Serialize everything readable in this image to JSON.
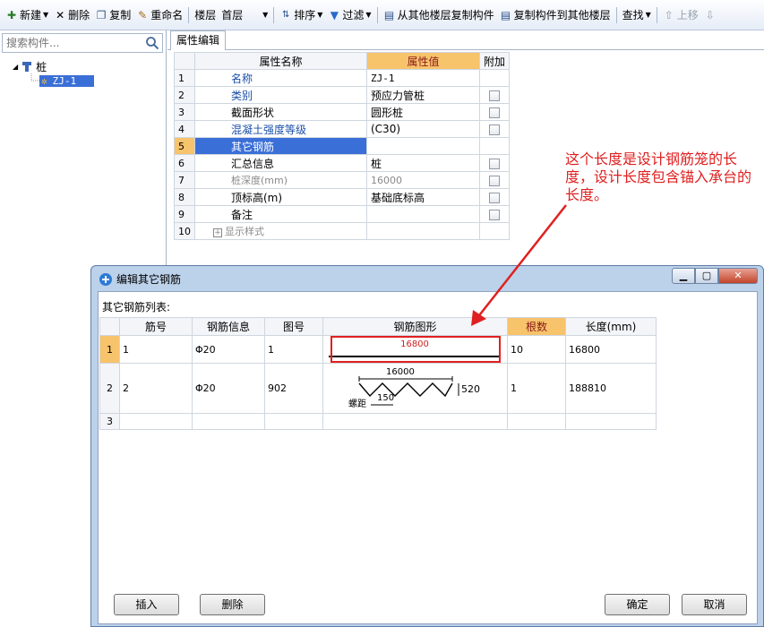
{
  "toolbar": {
    "new_label": "新建",
    "delete_label": "删除",
    "copy_label": "复制",
    "rename_label": "重命名",
    "floor_label": "楼层",
    "floor_value": "首层",
    "sort_label": "排序",
    "filter_label": "过滤",
    "copy_from_label": "从其他楼层复制构件",
    "copy_to_label": "复制构件到其他楼层",
    "find_label": "查找",
    "move_up_label": "上移"
  },
  "search": {
    "placeholder": "搜索构件..."
  },
  "tree": {
    "root_label": "桩",
    "child_label": "ZJ-1"
  },
  "tab": {
    "label": "属性编辑"
  },
  "properties": {
    "headers": [
      "属性名称",
      "属性值",
      "附加"
    ],
    "rows": [
      {
        "num": "1",
        "name": "名称",
        "value": "ZJ-1"
      },
      {
        "num": "2",
        "name": "类别",
        "value": "预应力管桩"
      },
      {
        "num": "3",
        "name": "截面形状",
        "value": "圆形桩"
      },
      {
        "num": "4",
        "name": "混凝土强度等级",
        "value": "(C30)"
      },
      {
        "num": "5",
        "name": "其它钢筋",
        "value": ""
      },
      {
        "num": "6",
        "name": "汇总信息",
        "value": "桩"
      },
      {
        "num": "7",
        "name": "桩深度(mm)",
        "value": "16000"
      },
      {
        "num": "8",
        "name": "顶标高(m)",
        "value": "基础底标高"
      },
      {
        "num": "9",
        "name": "备注",
        "value": ""
      },
      {
        "num": "10",
        "name": "显示样式",
        "value": ""
      }
    ]
  },
  "annotation": {
    "text": "这个长度是设计钢筋笼的长度，设计长度包含锚入承台的长度。"
  },
  "dialog": {
    "title": "编辑其它钢筋",
    "list_label": "其它钢筋列表:",
    "headers": [
      "筋号",
      "钢筋信息",
      "图号",
      "钢筋图形",
      "根数",
      "长度(mm)"
    ],
    "rows": [
      {
        "num": "1",
        "bar_no": "1",
        "info": "Φ20",
        "fig": "1",
        "shape_len": "16800",
        "count": "10",
        "length": "16800"
      },
      {
        "num": "2",
        "bar_no": "2",
        "info": "Φ20",
        "fig": "902",
        "shape_top": "16000",
        "shape_right": "520",
        "shape_pitch_label": "螺距",
        "shape_pitch": "150",
        "count": "1",
        "length": "188810"
      },
      {
        "num": "3",
        "bar_no": "",
        "info": "",
        "fig": "",
        "count": "",
        "length": ""
      }
    ],
    "insert_label": "插入",
    "delete_label": "删除",
    "ok_label": "确定",
    "cancel_label": "取消"
  },
  "colors": {
    "accent_red": "#e02020",
    "highlight_orange": "#f7c36b",
    "selection_blue": "#3b6fd8"
  }
}
